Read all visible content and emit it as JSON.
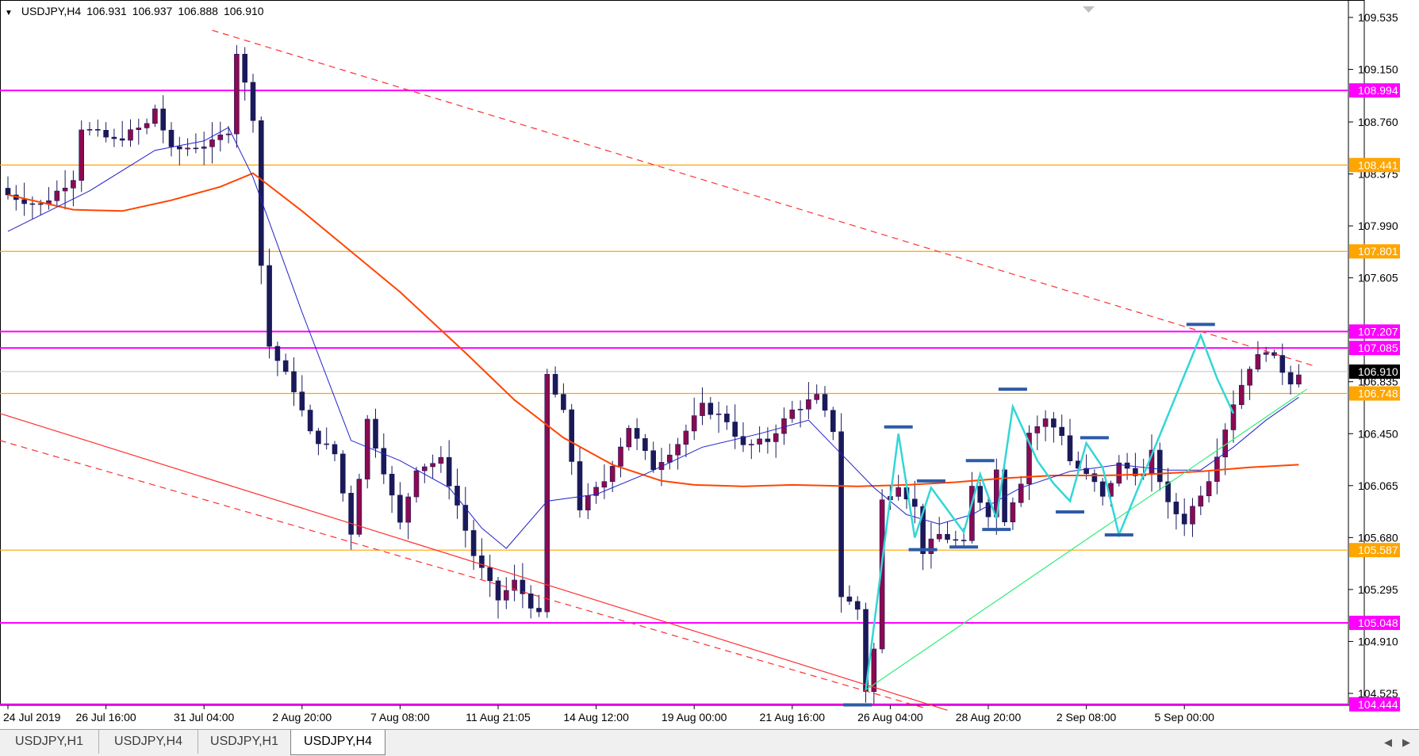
{
  "header": {
    "symbol": "USDJPY,H4",
    "open": "106.931",
    "high": "106.937",
    "low": "106.888",
    "close": "106.910"
  },
  "chart_data": {
    "type": "candlestick",
    "ylim": [
      104.3,
      109.6
    ],
    "price_ticks": [
      "109.535",
      "109.150",
      "108.760",
      "108.375",
      "107.990",
      "107.605",
      "107.220",
      "106.835",
      "106.450",
      "106.065",
      "105.680",
      "105.295",
      "104.910",
      "104.525"
    ],
    "level_labels": [
      {
        "value": 108.994,
        "text": "108.994",
        "kind": "support-resistance",
        "color": "#ff00ff"
      },
      {
        "value": 108.441,
        "text": "108.441",
        "kind": "minor-level",
        "color": "#ffa500"
      },
      {
        "value": 107.801,
        "text": "107.801",
        "kind": "minor-level",
        "color": "#ffa500"
      },
      {
        "value": 107.207,
        "text": "107.207",
        "kind": "support-resistance",
        "color": "#ff00ff"
      },
      {
        "value": 107.085,
        "text": "107.085",
        "kind": "support-resistance",
        "color": "#ff00ff"
      },
      {
        "value": 106.748,
        "text": "106.748",
        "kind": "minor-level",
        "color": "#ffa500"
      },
      {
        "value": 105.587,
        "text": "105.587",
        "kind": "minor-level",
        "color": "#ffa500"
      },
      {
        "value": 105.048,
        "text": "105.048",
        "kind": "support-resistance",
        "color": "#ff00ff"
      },
      {
        "value": 104.444,
        "text": "104.444",
        "kind": "support-resistance",
        "color": "#ff00ff"
      }
    ],
    "current_price": {
      "value": 106.91,
      "text": "106.910"
    },
    "time_labels": [
      {
        "i": 0,
        "text": "24 Jul 2019"
      },
      {
        "i": 12,
        "text": "26 Jul 16:00"
      },
      {
        "i": 24,
        "text": "31 Jul 04:00"
      },
      {
        "i": 36,
        "text": "2 Aug 20:00"
      },
      {
        "i": 48,
        "text": "7 Aug 08:00"
      },
      {
        "i": 60,
        "text": "11 Aug 21:05"
      },
      {
        "i": 72,
        "text": "14 Aug 12:00"
      },
      {
        "i": 84,
        "text": "19 Aug 00:00"
      },
      {
        "i": 96,
        "text": "21 Aug 16:00"
      },
      {
        "i": 108,
        "text": "26 Aug 04:00"
      },
      {
        "i": 120,
        "text": "28 Aug 20:00"
      },
      {
        "i": 132,
        "text": "2 Sep 08:00"
      },
      {
        "i": 144,
        "text": "5 Sep 00:00"
      }
    ],
    "anchors": [
      [
        0,
        108.22
      ],
      [
        4,
        108.14
      ],
      [
        8,
        108.35
      ],
      [
        9,
        108.72
      ],
      [
        13,
        108.62
      ],
      [
        17,
        108.74
      ],
      [
        18,
        108.86
      ],
      [
        20,
        108.55
      ],
      [
        25,
        108.6
      ],
      [
        27,
        108.7
      ],
      [
        28,
        109.28
      ],
      [
        30,
        108.8
      ],
      [
        31,
        107.7
      ],
      [
        32,
        107.1
      ],
      [
        35,
        106.78
      ],
      [
        37,
        106.45
      ],
      [
        40,
        106.3
      ],
      [
        42,
        105.72
      ],
      [
        44,
        106.55
      ],
      [
        46,
        106.18
      ],
      [
        48,
        105.78
      ],
      [
        50,
        106.2
      ],
      [
        53,
        106.25
      ],
      [
        55,
        105.92
      ],
      [
        57,
        105.55
      ],
      [
        60,
        105.22
      ],
      [
        62,
        105.35
      ],
      [
        65,
        105.1
      ],
      [
        66,
        106.88
      ],
      [
        68,
        106.6
      ],
      [
        70,
        105.9
      ],
      [
        73,
        106.1
      ],
      [
        76,
        106.5
      ],
      [
        79,
        106.2
      ],
      [
        82,
        106.38
      ],
      [
        85,
        106.65
      ],
      [
        88,
        106.55
      ],
      [
        90,
        106.35
      ],
      [
        93,
        106.4
      ],
      [
        96,
        106.62
      ],
      [
        99,
        106.72
      ],
      [
        101,
        106.48
      ],
      [
        102,
        105.25
      ],
      [
        104,
        105.15
      ],
      [
        105,
        104.55
      ],
      [
        106,
        104.85
      ],
      [
        107,
        105.95
      ],
      [
        109,
        106.08
      ],
      [
        111,
        105.9
      ],
      [
        112,
        105.58
      ],
      [
        114,
        105.7
      ],
      [
        117,
        105.63
      ],
      [
        118,
        106.05
      ],
      [
        120,
        105.86
      ],
      [
        121,
        106.18
      ],
      [
        122,
        105.82
      ],
      [
        124,
        106.1
      ],
      [
        125,
        106.46
      ],
      [
        127,
        106.55
      ],
      [
        129,
        106.45
      ],
      [
        130,
        106.25
      ],
      [
        133,
        106.08
      ],
      [
        134,
        105.97
      ],
      [
        136,
        106.22
      ],
      [
        139,
        106.14
      ],
      [
        140,
        106.3
      ],
      [
        142,
        105.92
      ],
      [
        144,
        105.8
      ],
      [
        147,
        106.12
      ],
      [
        150,
        106.68
      ],
      [
        152,
        106.95
      ],
      [
        154,
        107.08
      ],
      [
        156,
        106.92
      ],
      [
        157,
        106.84
      ],
      [
        158,
        106.91
      ]
    ],
    "ma_blue": [
      [
        0,
        107.95
      ],
      [
        10,
        108.25
      ],
      [
        18,
        108.55
      ],
      [
        24,
        108.62
      ],
      [
        27,
        108.72
      ],
      [
        30,
        108.35
      ],
      [
        36,
        107.35
      ],
      [
        42,
        106.4
      ],
      [
        48,
        106.25
      ],
      [
        54,
        106.05
      ],
      [
        58,
        105.75
      ],
      [
        61,
        105.6
      ],
      [
        66,
        105.95
      ],
      [
        72,
        106.0
      ],
      [
        78,
        106.15
      ],
      [
        85,
        106.35
      ],
      [
        92,
        106.45
      ],
      [
        98,
        106.55
      ],
      [
        102,
        106.3
      ],
      [
        106,
        106.05
      ],
      [
        110,
        105.85
      ],
      [
        114,
        105.78
      ],
      [
        118,
        105.85
      ],
      [
        124,
        106.05
      ],
      [
        130,
        106.17
      ],
      [
        136,
        106.22
      ],
      [
        142,
        106.18
      ],
      [
        146,
        106.18
      ],
      [
        150,
        106.35
      ],
      [
        154,
        106.55
      ],
      [
        158,
        106.72
      ]
    ],
    "ma_red": [
      [
        0,
        108.22
      ],
      [
        8,
        108.11
      ],
      [
        14,
        108.1
      ],
      [
        20,
        108.18
      ],
      [
        26,
        108.28
      ],
      [
        30,
        108.38
      ],
      [
        36,
        108.1
      ],
      [
        42,
        107.8
      ],
      [
        48,
        107.5
      ],
      [
        56,
        107.05
      ],
      [
        62,
        106.7
      ],
      [
        68,
        106.42
      ],
      [
        74,
        106.22
      ],
      [
        80,
        106.1
      ],
      [
        84,
        106.07
      ],
      [
        90,
        106.06
      ],
      [
        96,
        106.07
      ],
      [
        104,
        106.06
      ],
      [
        110,
        106.07
      ],
      [
        116,
        106.09
      ],
      [
        122,
        106.12
      ],
      [
        128,
        106.14
      ],
      [
        134,
        106.14
      ],
      [
        140,
        106.15
      ],
      [
        146,
        106.17
      ],
      [
        152,
        106.2
      ],
      [
        158,
        106.22
      ]
    ],
    "trendlines": [
      {
        "kind": "resistance-dashed",
        "color": "#ff3030",
        "from": [
          25,
          109.44
        ],
        "to": [
          160,
          106.95
        ]
      },
      {
        "kind": "channel-solid",
        "color": "#ff3030",
        "from": [
          -1,
          106.6
        ],
        "to": [
          115,
          104.4
        ]
      },
      {
        "kind": "channel-dashed",
        "color": "#ff3030",
        "from": [
          -1,
          106.4
        ],
        "to": [
          112,
          104.42
        ]
      },
      {
        "kind": "uptrend",
        "color": "#33ee77",
        "from": [
          105,
          104.55
        ],
        "to": [
          159,
          106.78
        ]
      }
    ],
    "zigzag": [
      [
        105,
        104.55
      ],
      [
        109,
        106.45
      ],
      [
        111,
        105.68
      ],
      [
        113,
        106.05
      ],
      [
        117,
        105.72
      ],
      [
        119,
        106.15
      ],
      [
        121,
        105.82
      ],
      [
        123,
        106.65
      ],
      [
        126,
        106.25
      ],
      [
        128,
        106.08
      ],
      [
        130,
        105.95
      ],
      [
        132,
        106.38
      ],
      [
        134,
        106.2
      ],
      [
        136,
        105.7
      ],
      [
        146,
        107.18
      ],
      [
        148,
        106.86
      ],
      [
        150,
        106.6
      ]
    ],
    "markers": [
      [
        104,
        104.44
      ],
      [
        109,
        106.5
      ],
      [
        112,
        105.59
      ],
      [
        113,
        106.1
      ],
      [
        117,
        105.61
      ],
      [
        119,
        106.25
      ],
      [
        121,
        105.74
      ],
      [
        123,
        106.78
      ],
      [
        130,
        105.87
      ],
      [
        133,
        106.42
      ],
      [
        136,
        105.7
      ],
      [
        146,
        107.26
      ]
    ]
  },
  "tabs": [
    {
      "label": "USDJPY,H1",
      "active": false
    },
    {
      "label": "USDJPY,H4",
      "active": false
    },
    {
      "label": "USDJPY,H1",
      "active": false
    },
    {
      "label": "USDJPY,H4",
      "active": true
    }
  ]
}
